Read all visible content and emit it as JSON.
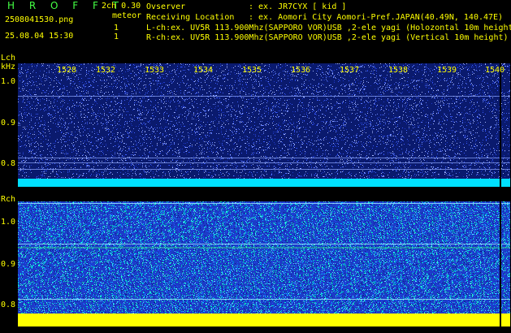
{
  "header": {
    "logo": "H R O F F T",
    "version": "2ch 0.30",
    "meteor_label": "meteor",
    "filename": "2508041530.png",
    "datetime": "25.08.04 15:30",
    "count_l": "1",
    "count_r": "1",
    "observer_label": "Ovserver",
    "observer_value": ": ex. JR7CYX [ kid ]",
    "location_label": "Receiving Location",
    "location_value": ": ex. Aomori City Aomori-Pref.JAPAN(40.49N, 140.47E)",
    "lch_line": "L-ch:ex. UV5R 113.900Mhz(SAPPORO VOR)USB ,2-ele yagi (Holozontal 10m height",
    "rch_line": "R-ch:ex. UV5R 113.900Mhz(SAPPORO VOR)USB ,2-ele yagi (Vertical 10m height)"
  },
  "lch": {
    "label": "Lch",
    "unit": "kHz",
    "ticks": [
      "1.0",
      "0.9",
      "0.8"
    ]
  },
  "rch": {
    "label": "Rch",
    "ticks": [
      "1.0",
      "0.9",
      "0.8"
    ]
  },
  "time_ticks": [
    "1528",
    "1532",
    "1533",
    "1534",
    "1535",
    "1536",
    "1537",
    "1538",
    "1539",
    "1540"
  ],
  "colors": {
    "text": "#ffff00",
    "logo": "#44ff44",
    "background_lch": "#0a1a6e",
    "background_rch": "#1c3cc8",
    "baseline_lch": "#00e0ff",
    "baseline_rch": "#ffff00"
  }
}
